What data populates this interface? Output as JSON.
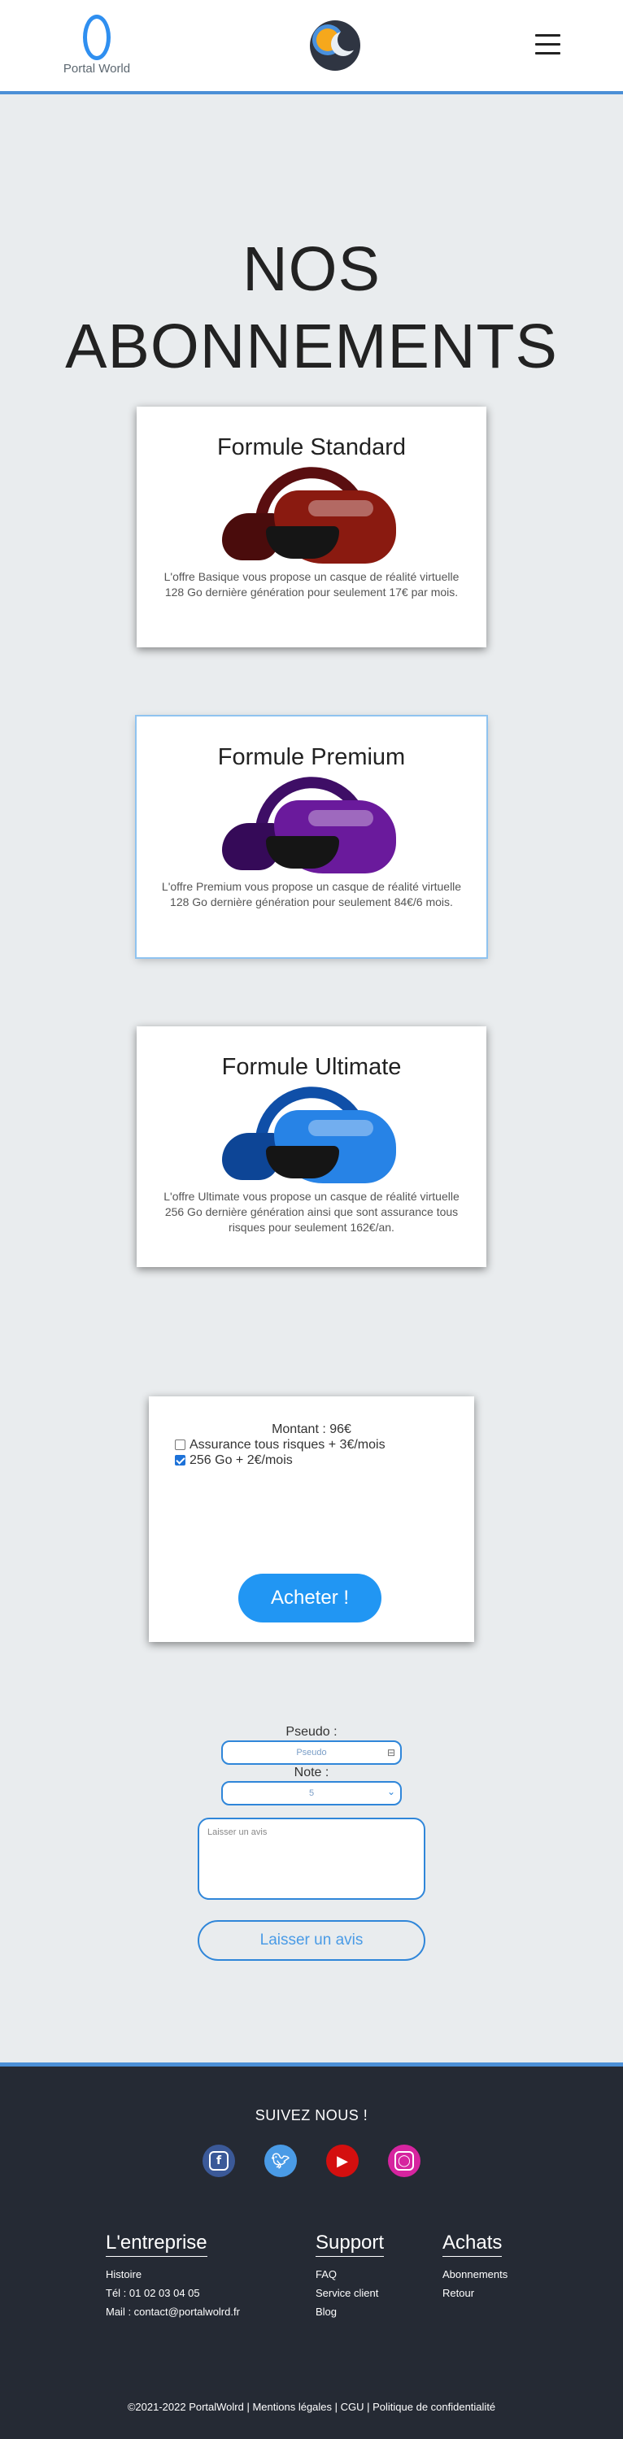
{
  "header": {
    "logo_text": "Portal World"
  },
  "page_title": "NOS ABONNEMENTS",
  "plans": [
    {
      "title": "Formule Standard",
      "description": "L'offre Basique vous propose un casque de réalité virtuelle 128 Go dernière génération pour seulement 17€ par mois.",
      "color": "#7a1410"
    },
    {
      "title": "Formule Premium",
      "description": "L'offre Premium vous propose un casque de réalité virtuelle 128 Go dernière génération pour seulement 84€/6 mois.",
      "color": "#5e1a8c"
    },
    {
      "title": "Formule Ultimate",
      "description": "L'offre Ultimate vous propose un casque de réalité virtuelle 256 Go dernière génération ainsi que sont assurance tous risques pour seulement 162€/an.",
      "color": "#1a6fd8"
    }
  ],
  "purchase": {
    "amount": "Montant : 96€",
    "options": [
      {
        "label": "Assurance tous risques + 3€/mois",
        "checked": false
      },
      {
        "label": "256 Go + 2€/mois",
        "checked": true
      }
    ],
    "buy_label": "Acheter !"
  },
  "review": {
    "pseudo_label": "Pseudo :",
    "pseudo_placeholder": "Pseudo",
    "note_label": "Note :",
    "note_value": "5",
    "comment_placeholder": "Laisser un avis",
    "submit_label": "Laisser un avis"
  },
  "footer": {
    "follow": "SUIVEZ NOUS !",
    "socials": [
      "facebook-icon",
      "twitter-icon",
      "youtube-icon",
      "instagram-icon"
    ],
    "columns": [
      {
        "title": "L'entreprise",
        "links": [
          "Histoire",
          "Tél : 01 02 03 04 05",
          "Mail : contact@portalwolrd.fr"
        ]
      },
      {
        "title": "Support",
        "links": [
          "FAQ",
          "Service client",
          "Blog"
        ]
      },
      {
        "title": "Achats",
        "links": [
          "Abonnements",
          "Retour"
        ]
      }
    ],
    "copyright": "©2021-2022 PortalWolrd | Mentions légales | CGU | Politique de confidentialité"
  }
}
